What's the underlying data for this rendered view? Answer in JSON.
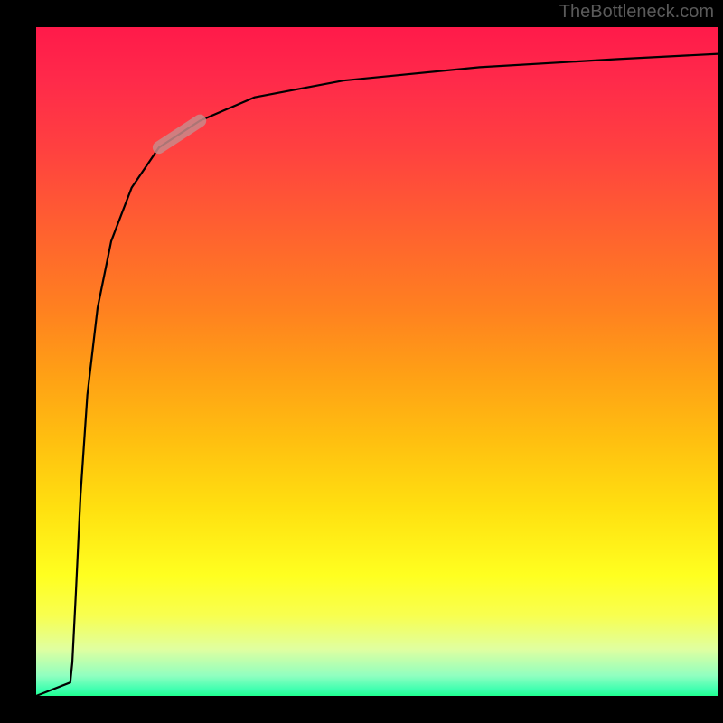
{
  "watermark": "TheBottleneck.com",
  "chart_data": {
    "type": "line",
    "title": "",
    "xlabel": "",
    "ylabel": "",
    "xlim": [
      0,
      100
    ],
    "ylim": [
      0,
      100
    ],
    "grid": false,
    "series": [
      {
        "name": "curve",
        "x": [
          0,
          5,
          5.3,
          5.8,
          6.5,
          7.5,
          9,
          11,
          14,
          18,
          24,
          32,
          45,
          65,
          85,
          100
        ],
        "values": [
          0,
          2,
          5,
          15,
          30,
          45,
          58,
          68,
          76,
          82,
          86,
          89.5,
          92,
          94,
          95.2,
          96
        ]
      },
      {
        "name": "highlight-segment",
        "x": [
          18,
          24
        ],
        "values": [
          82,
          86
        ]
      }
    ],
    "colors": {
      "curve": "#000000",
      "highlight": "#c98a8a",
      "gradient_top": "#ff1a4a",
      "gradient_mid": "#ffe010",
      "gradient_bottom": "#20ff90"
    }
  }
}
